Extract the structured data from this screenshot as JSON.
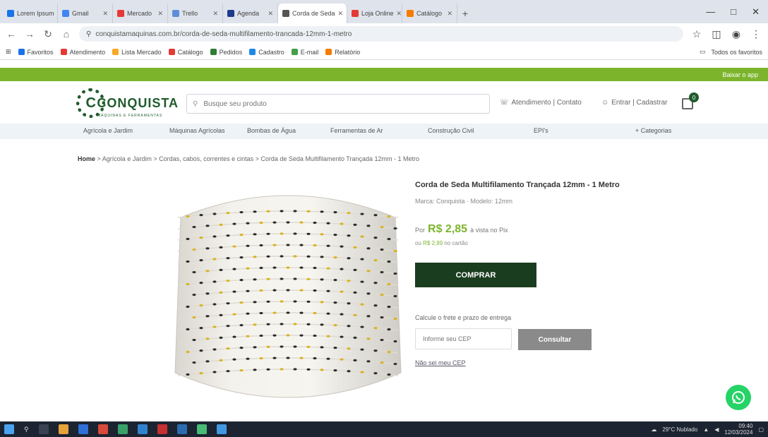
{
  "browser": {
    "tabs": [
      {
        "label": "Lorem Ipsum",
        "color": "#1a73e8"
      },
      {
        "label": "Gmail",
        "color": "#4285f4"
      },
      {
        "label": "Mercado",
        "color": "#e53935"
      },
      {
        "label": "Trello",
        "color": "#5d8fd9"
      },
      {
        "label": "Agenda",
        "color": "#1e3a8a"
      },
      {
        "label": "Corda de Seda",
        "color": "#555555",
        "active": true
      },
      {
        "label": "Loja Online",
        "color": "#e53935"
      },
      {
        "label": "Catálogo",
        "color": "#f57c00"
      }
    ],
    "new_tab": "+",
    "url": "conquistamaquinas.com.br/corda-de-seda-multifilamento-trancada-12mm-1-metro",
    "bookmarks": [
      {
        "label": "Favoritos",
        "color": "#1a73e8"
      },
      {
        "label": "Atendimento",
        "color": "#e53935"
      },
      {
        "label": "Lista Mercado",
        "color": "#f9a825"
      },
      {
        "label": "Catálogo",
        "color": "#e53935"
      },
      {
        "label": "Pedidos",
        "color": "#2e7d32"
      },
      {
        "label": "Cadastro",
        "color": "#1e88e5"
      },
      {
        "label": "E-mail",
        "color": "#43a047"
      },
      {
        "label": "Relatório",
        "color": "#f57c00"
      }
    ],
    "bookmarks_right": "Todos os favoritos"
  },
  "site": {
    "topbar_text": "Baixar o app",
    "logo_word": "CONQUISTA",
    "logo_sub": "MÁQUINAS E FERRAMENTAS",
    "search_placeholder": "Busque seu produto",
    "support_label": "Atendimento | Contato",
    "login_label": "Entrar | Cadastrar",
    "cart_count": "0",
    "categories": [
      "Agrícola e Jardim",
      "Máquinas Agrícolas",
      "Bombas de Água",
      "Ferramentas de Ar",
      "Construção Civil",
      "EPI's",
      "+ Categorias"
    ]
  },
  "breadcrumb": {
    "home": "Home",
    "path": "> Agrícola e Jardim > Cordas, cabos, correntes e cintas > Corda de Seda Multifilamento Trançada 12mm - 1 Metro"
  },
  "product": {
    "title": "Corda de Seda Multifilamento Trançada 12mm - 1 Metro",
    "meta": "Marca: Conquista · Modelo: 12mm",
    "price_prefix": "Por",
    "price": "R$ 2,85",
    "price_suffix": "à vista no Pix",
    "installment_prefix": "ou",
    "installment_value": "R$ 2,99",
    "installment_suffix": "no cartão",
    "buy_label": "COMPRAR",
    "shipping_label": "Calcule o frete e prazo de entrega",
    "cep_placeholder": "Informe seu CEP",
    "consult_label": "Consultar",
    "no_cep_link": "Não sei meu CEP"
  },
  "taskbar": {
    "weather": "29°C Nublado",
    "clock_time": "09:40",
    "clock_date": "12/03/2024"
  }
}
